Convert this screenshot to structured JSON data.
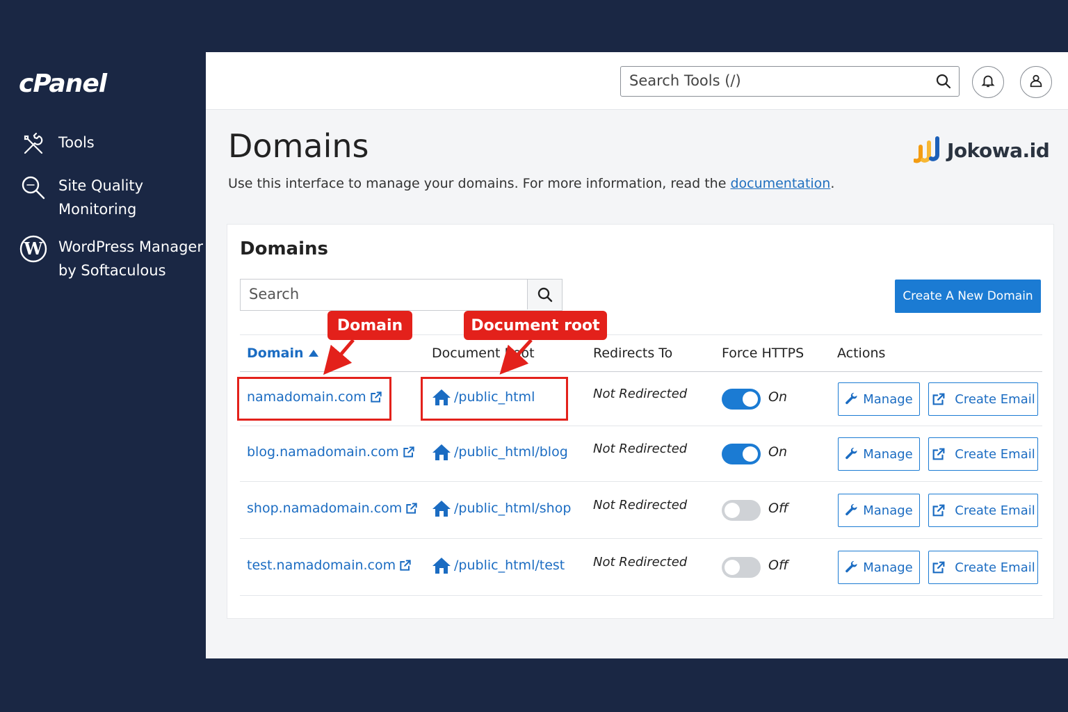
{
  "sidebar": {
    "logo": "cPanel",
    "items": [
      {
        "label": "Tools",
        "icon": "tools-icon"
      },
      {
        "label": "Site Quality Monitoring",
        "icon": "magnifier-icon"
      },
      {
        "label": "WordPress Manager by Softaculous",
        "icon": "wordpress-icon"
      }
    ]
  },
  "topbar": {
    "search_placeholder": "Search Tools (/)",
    "notifications_icon": "bell-icon",
    "user_icon": "user-icon"
  },
  "page": {
    "title": "Domains",
    "description_prefix": "Use this interface to manage your domains. For more information, read the ",
    "description_link": "documentation",
    "description_suffix": "."
  },
  "brand": {
    "name": "Jokowa.id",
    "accent": "#f39c12"
  },
  "card": {
    "title": "Domains",
    "search_placeholder": "Search",
    "create_button": "Create A New Domain"
  },
  "table": {
    "headers": {
      "domain": "Domain",
      "root": "Document Root",
      "redirects": "Redirects To",
      "https": "Force HTTPS",
      "actions": "Actions"
    },
    "rows": [
      {
        "domain": "namadomain.com",
        "root": "/public_html",
        "redirect": "Not Redirected",
        "https_on": true,
        "https_label": "On",
        "manage": "Manage",
        "email": "Create Email"
      },
      {
        "domain": "blog.namadomain.com",
        "root": "/public_html/blog",
        "redirect": "Not Redirected",
        "https_on": true,
        "https_label": "On",
        "manage": "Manage",
        "email": "Create Email"
      },
      {
        "domain": "shop.namadomain.com",
        "root": "/public_html/shop",
        "redirect": "Not Redirected",
        "https_on": false,
        "https_label": "Off",
        "manage": "Manage",
        "email": "Create Email"
      },
      {
        "domain": "test.namadomain.com",
        "root": "/public_html/test",
        "redirect": "Not Redirected",
        "https_on": false,
        "https_label": "Off",
        "manage": "Manage",
        "email": "Create Email"
      }
    ]
  },
  "annotations": {
    "domain_label": "Domain",
    "root_label": "Document root"
  },
  "colors": {
    "sidebar_bg": "#1a2744",
    "primary": "#1b7bd3",
    "link": "#1b6cc2",
    "annotation_red": "#e3211b"
  }
}
